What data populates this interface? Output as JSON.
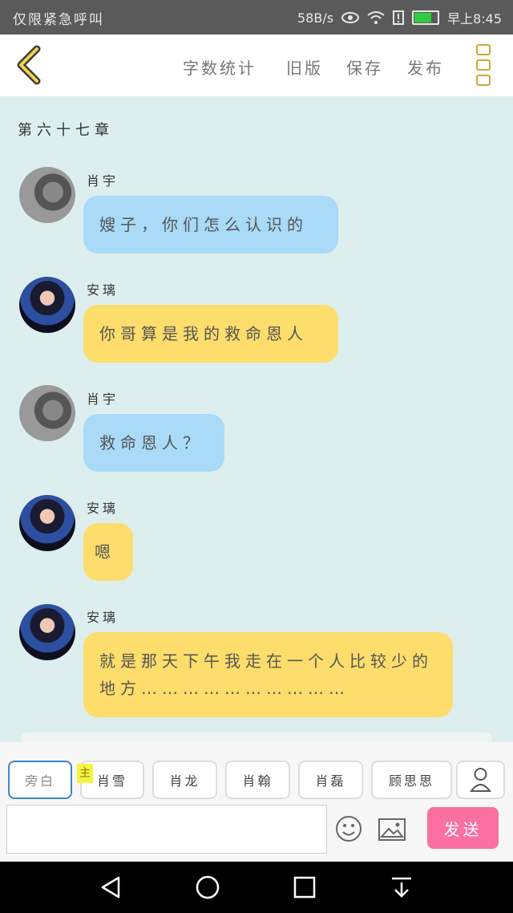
{
  "status_bar": {
    "carrier": "仅限紧急呼叫",
    "network_speed": "58B/s",
    "time": "早上8:45",
    "battery_level": 0.7
  },
  "toolbar": {
    "back_icon": "chevron-left-icon",
    "word_count_label": "字数统计",
    "old_version_label": "旧版",
    "save_label": "保存",
    "publish_label": "发布",
    "menu_icon": "more-vertical-icon"
  },
  "chapter_title": "第六十七章",
  "messages": [
    {
      "speaker": "肖宇",
      "text": "嫂子，你们怎么认识的",
      "color": "#a9daf7"
    },
    {
      "speaker": "安璃",
      "text": "你哥算是我的救命恩人",
      "color": "#fddd6c"
    },
    {
      "speaker": "肖宇",
      "text": "救命恩人？",
      "color": "#a9daf7"
    },
    {
      "speaker": "安璃",
      "text": "嗯",
      "color": "#fddd6c"
    },
    {
      "speaker": "安璃",
      "text": "就是那天下午我走在一个人比较少的地方…………………………",
      "color": "#fddd6c"
    }
  ],
  "roles": {
    "narration": "旁白",
    "main_mark": "主",
    "items": [
      "肖雪",
      "肖龙",
      "肖翰",
      "肖磊",
      "顾思思"
    ],
    "user_icon": "person-icon"
  },
  "composer": {
    "input_value": "",
    "emoji_icon": "emoji-icon",
    "image_icon": "image-icon",
    "send_label": "发送"
  },
  "nav_bar": {
    "icons": [
      "back-triangle-icon",
      "home-circle-icon",
      "recents-square-icon",
      "notification-down-icon"
    ]
  }
}
